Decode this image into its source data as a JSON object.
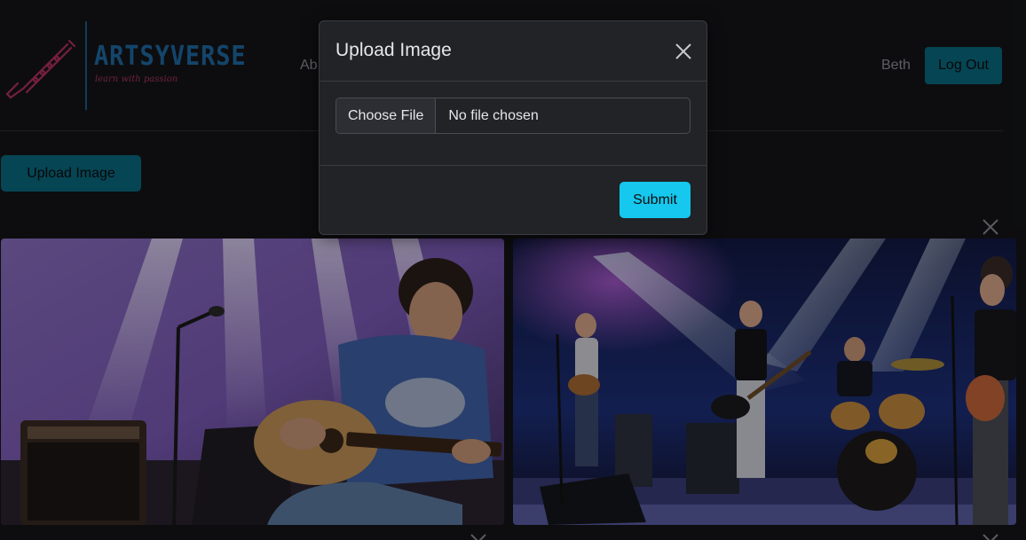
{
  "header": {
    "logo": {
      "brand": "ARTSYVERSE",
      "tagline": "learn with passion"
    },
    "nav_about": "Ab",
    "username": "Beth",
    "logout_label": "Log Out"
  },
  "main": {
    "upload_button_label": "Upload Image",
    "gallery": [
      {
        "image": "solo-guitarist-on-stage-photo"
      },
      {
        "image": "band-performing-on-stage-photo"
      }
    ]
  },
  "modal": {
    "title": "Upload Image",
    "choose_file_label": "Choose File",
    "file_status": "No file chosen",
    "submit_label": "Submit"
  },
  "colors": {
    "accent": "#16c8ee",
    "accent_dimmed": "#0a6b80",
    "page_background": "#141517",
    "modal_background": "#212327"
  }
}
